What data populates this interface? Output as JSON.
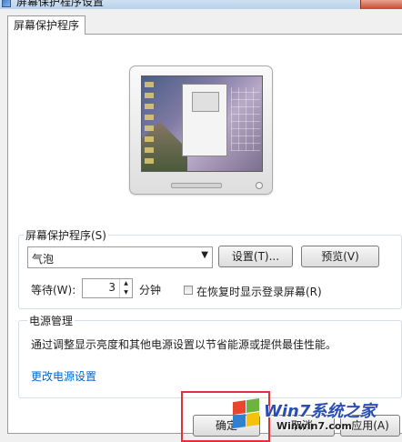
{
  "window": {
    "title": "屏幕保护程序设置"
  },
  "tab": {
    "label": "屏幕保护程序"
  },
  "screensaver": {
    "group_label": "屏幕保护程序(S)",
    "selected": "气泡",
    "settings_label": "设置(T)...",
    "preview_label": "预览(V)",
    "wait_label": "等待(W):",
    "wait_value": "3",
    "minutes_label": "分钟",
    "resume_checkbox_label": "在恢复时显示登录屏幕(R)",
    "resume_checked": false
  },
  "power": {
    "group_label": "电源管理",
    "description": "通过调整显示亮度和其他电源设置以节省能源或提供最佳性能。",
    "link_label": "更改电源设置"
  },
  "footer": {
    "ok_label": "确定",
    "cancel_label": "取消",
    "apply_label": "应用(A)"
  },
  "watermark": {
    "text": "Win7系统之家",
    "url": "Winwin7.com",
    "colors": [
      "#e8472b",
      "#6db33f",
      "#2f80d1",
      "#f4c20d"
    ]
  },
  "colors": {
    "highlight": "#e0323a",
    "link": "#0066cc"
  }
}
